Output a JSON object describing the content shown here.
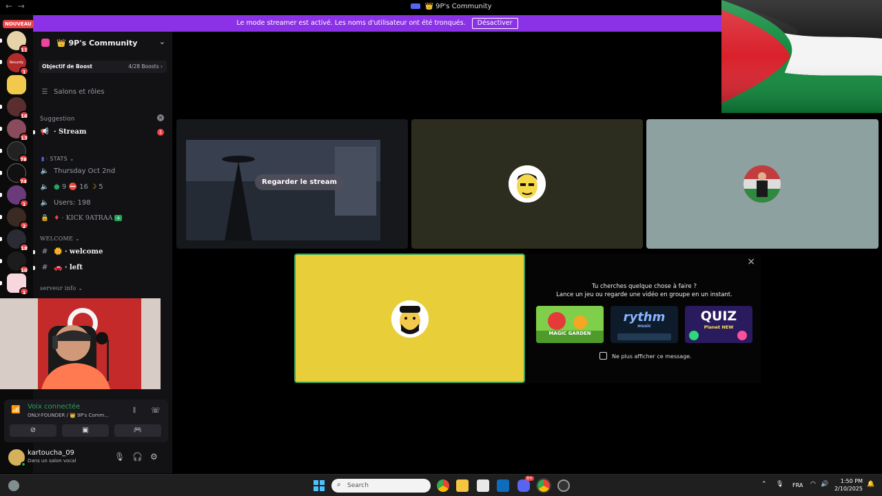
{
  "window": {
    "back_glyph": "←",
    "forward_glyph": "→",
    "title": "👑 9P's Community"
  },
  "banner": {
    "text": "Le mode streamer est activé. Les noms d'utilisateur ont été tronqués.",
    "button": "Désactiver",
    "color": "#8b32e6"
  },
  "rail": {
    "new_badge": "NOUVEAU",
    "servers": [
      {
        "label": "",
        "count": "11"
      },
      {
        "label": "Resurdy",
        "count": "1"
      },
      {
        "label": "",
        "count": ""
      },
      {
        "label": "",
        "count": "16"
      },
      {
        "label": "",
        "count": "13"
      },
      {
        "label": "",
        "count": "76"
      },
      {
        "label": "",
        "count": "74"
      },
      {
        "label": "",
        "count": "1"
      },
      {
        "label": "",
        "count": "2"
      },
      {
        "label": "",
        "count": "18"
      },
      {
        "label": "",
        "count": "10"
      },
      {
        "label": "",
        "count": "1"
      }
    ]
  },
  "sidebar": {
    "server_name": "👑 9P's Community",
    "boost_label": "Objectif de Boost",
    "boost_count": "4/28 Boosts",
    "boost_chevron": "›",
    "channels_roles": "Salons et rôles",
    "suggestion_label": "Suggestion",
    "suggestion_close": "×",
    "stream_channel": "· Stream",
    "stream_badge": "1",
    "stats_category": "· STATS",
    "stats": {
      "date": "Thursday Oct 2nd",
      "online": "9",
      "dnd": "16",
      "idle": "5",
      "users": "Users: 198",
      "kick": "· KICK 9ATRAA"
    },
    "welcome_category": "WELCOME",
    "welcome_channel": "· welcome",
    "left_channel": "· left",
    "info_category": "serveur info"
  },
  "voice": {
    "status": "Voix connectée",
    "channel": "ONLY-FOUNDER / 👑 9P's Comm..."
  },
  "user": {
    "name": "kartoucha_09",
    "status": "Dans un salon vocal"
  },
  "stage": {
    "watch_button": "Regarder le stream"
  },
  "activity": {
    "close": "×",
    "title_line1": "Tu cherches quelque chose à faire ?",
    "title_line2": "Lance un jeu ou regarde une vidéo en groupe en un instant.",
    "games": [
      "MAGIC GARDEN",
      "rythm",
      "QUIZ"
    ],
    "game_subs": [
      "",
      "music",
      "Planet NEW"
    ],
    "dont_show": "Ne plus afficher ce message."
  },
  "taskbar": {
    "search_placeholder": "Search",
    "language": "FRA",
    "time": "1:50 PM",
    "date": "2/10/2025",
    "discord_badge": "9+"
  }
}
